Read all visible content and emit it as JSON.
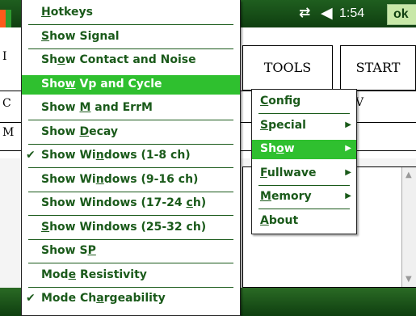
{
  "status": {
    "time": "1:54",
    "ok_label": "ok"
  },
  "background": {
    "tabs": [
      "TOOLS",
      "START"
    ],
    "ghost_letters": [
      "I",
      "C",
      "M",
      "V"
    ]
  },
  "main_menu": {
    "items": [
      {
        "pre": "",
        "u": "H",
        "post": "otkeys",
        "checked": false,
        "selected": false
      },
      {
        "pre": "",
        "u": "S",
        "post": "how Signal",
        "checked": false,
        "selected": false
      },
      {
        "pre": "Sh",
        "u": "o",
        "post": "w Contact and Noise",
        "checked": false,
        "selected": false
      },
      {
        "pre": "Sho",
        "u": "w",
        "post": " Vp and Cycle",
        "checked": false,
        "selected": true
      },
      {
        "pre": "Show ",
        "u": "M",
        "post": " and ErrM",
        "checked": false,
        "selected": false
      },
      {
        "pre": "Show ",
        "u": "D",
        "post": "ecay",
        "checked": false,
        "selected": false
      },
      {
        "pre": "Show Wi",
        "u": "n",
        "post": "dows (1-8 ch)",
        "checked": true,
        "selected": false
      },
      {
        "pre": "Show Wi",
        "u": "n",
        "post": "dows (9-16 ch)",
        "checked": false,
        "selected": false
      },
      {
        "pre": "Show Windows (17-24 ",
        "u": "c",
        "post": "h)",
        "checked": false,
        "selected": false
      },
      {
        "pre": "",
        "u": "S",
        "post": "how Windows (25-32 ch)",
        "checked": false,
        "selected": false
      },
      {
        "pre": "Show S",
        "u": "P",
        "post": "",
        "checked": false,
        "selected": false
      },
      {
        "pre": "Mod",
        "u": "e",
        "post": " Resistivity",
        "checked": false,
        "selected": false
      },
      {
        "pre": "Mode Ch",
        "u": "a",
        "post": "rgeability",
        "checked": true,
        "selected": false
      }
    ]
  },
  "sub_menu": {
    "items": [
      {
        "pre": "",
        "u": "C",
        "post": "onfig",
        "arrow": false,
        "selected": false
      },
      {
        "pre": "",
        "u": "S",
        "post": "pecial",
        "arrow": true,
        "selected": false
      },
      {
        "pre": "Sh",
        "u": "o",
        "post": "w",
        "arrow": true,
        "selected": true
      },
      {
        "pre": "",
        "u": "F",
        "post": "ullwave",
        "arrow": true,
        "selected": false
      },
      {
        "pre": "",
        "u": "M",
        "post": "emory",
        "arrow": true,
        "selected": false
      },
      {
        "pre": "",
        "u": "A",
        "post": "bout",
        "arrow": false,
        "selected": false
      }
    ]
  },
  "icons": {
    "checkmark": "checkmark-icon",
    "submenu_arrow": "chevron-right-icon",
    "connectivity": "connectivity-icon",
    "volume": "volume-icon",
    "start": "start-flag-icon"
  }
}
